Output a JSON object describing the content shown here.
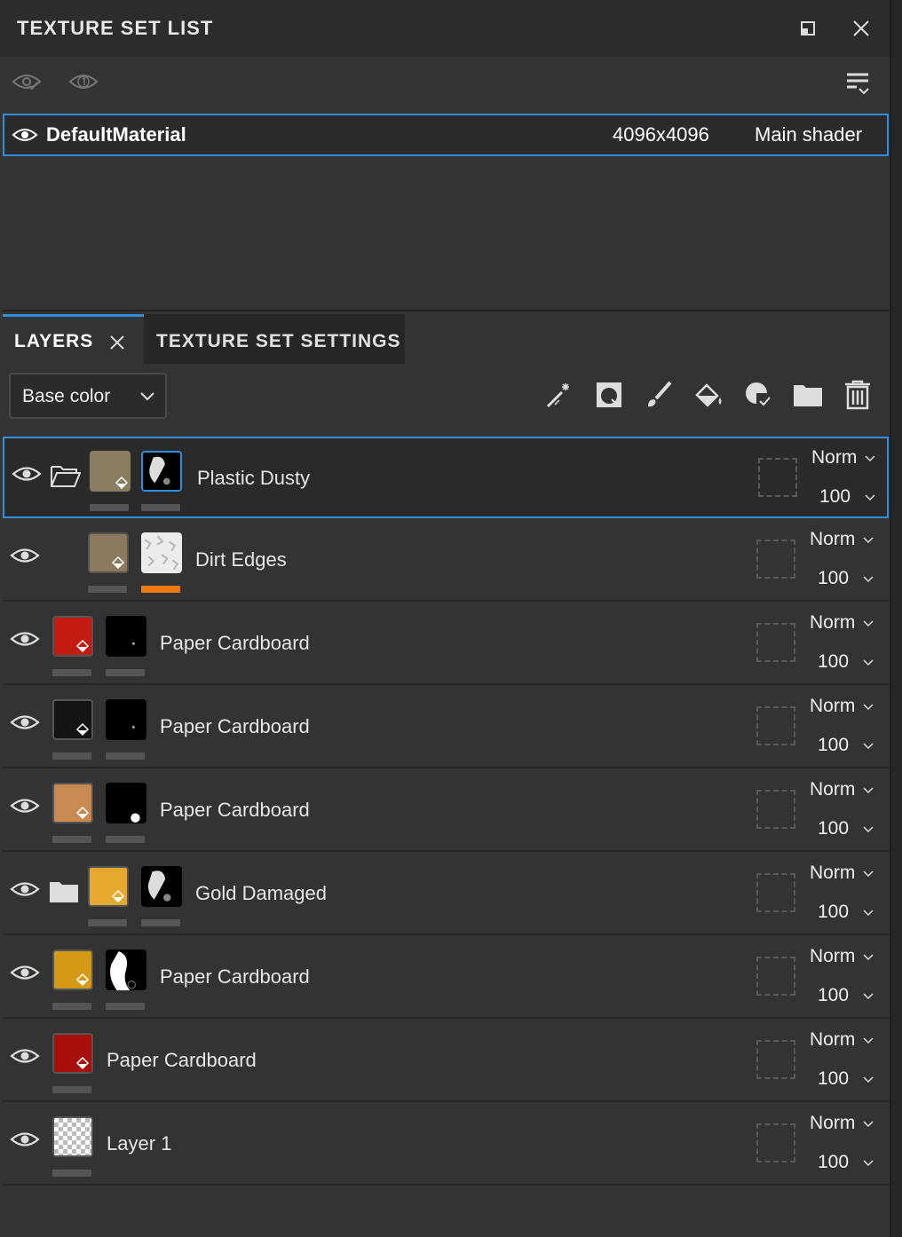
{
  "panel": {
    "title": "TEXTURE SET LIST"
  },
  "texture_set": {
    "name": "DefaultMaterial",
    "resolution": "4096x4096",
    "shader": "Main shader"
  },
  "tabs": [
    {
      "label": "LAYERS"
    },
    {
      "label": "TEXTURE SET SETTINGS"
    }
  ],
  "channel": {
    "selected": "Base color"
  },
  "layer_tool_icons": [
    "magic-wand-icon",
    "add-fill-mask-icon",
    "paint-brush-icon",
    "fill-bucket-icon",
    "smart-mask-icon",
    "folder-icon",
    "trash-icon"
  ],
  "layers": [
    {
      "name": "Plastic Dusty",
      "blend": "Norm",
      "opacity": "100",
      "color": "#8a7d62",
      "mask": "black-white",
      "folder": "open"
    },
    {
      "name": "Dirt Edges",
      "blend": "Norm",
      "opacity": "100",
      "color": "#8c7a5e",
      "mask": "white-pattern",
      "folder": "none"
    },
    {
      "name": "Paper Cardboard",
      "blend": "Norm",
      "opacity": "100",
      "color": "#c41a12",
      "mask": "black",
      "folder": "none"
    },
    {
      "name": "Paper Cardboard",
      "blend": "Norm",
      "opacity": "100",
      "color": "#141414",
      "mask": "black",
      "folder": "none"
    },
    {
      "name": "Paper Cardboard",
      "blend": "Norm",
      "opacity": "100",
      "color": "#c98a52",
      "mask": "black-dot",
      "folder": "none"
    },
    {
      "name": "Gold Damaged",
      "blend": "Norm",
      "opacity": "100",
      "color": "#e6a92e",
      "mask": "black-white",
      "folder": "closed"
    },
    {
      "name": "Paper Cardboard",
      "blend": "Norm",
      "opacity": "100",
      "color": "#d49a14",
      "mask": "white-shape",
      "folder": "none"
    },
    {
      "name": "Paper Cardboard",
      "blend": "Norm",
      "opacity": "100",
      "color": "#a8100e",
      "mask": "none",
      "folder": "none"
    },
    {
      "name": "Layer 1",
      "blend": "Norm",
      "opacity": "100",
      "color": "checker",
      "mask": "none",
      "folder": "none"
    }
  ],
  "colors": {
    "accent": "#2f8ee0",
    "highlight": "#f07a10"
  }
}
